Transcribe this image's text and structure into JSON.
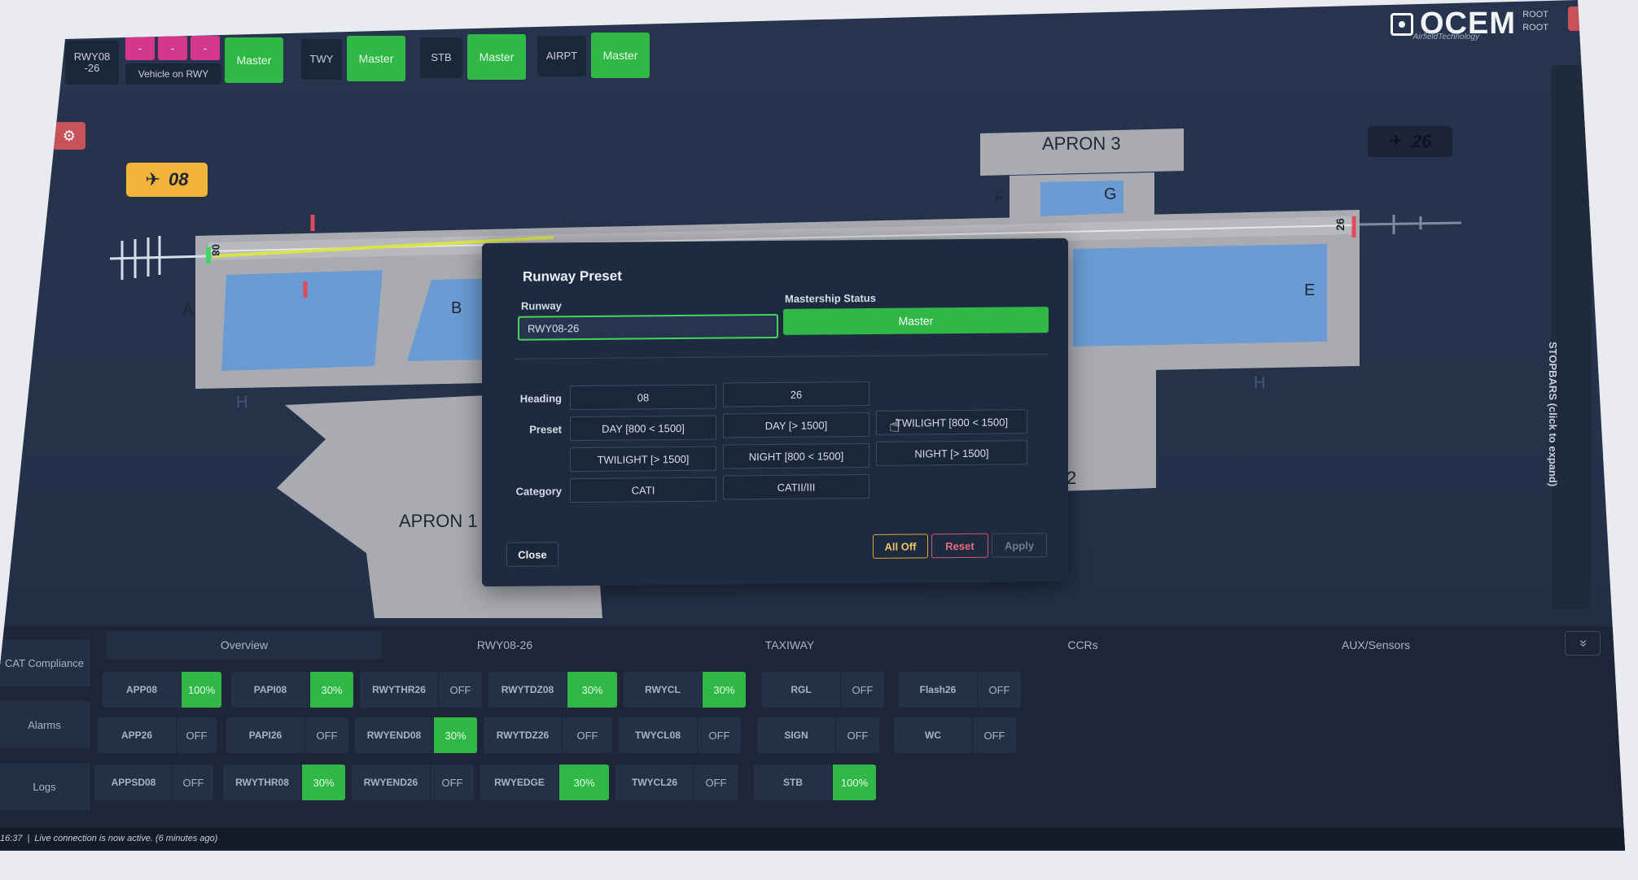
{
  "toolbar": {
    "runway_id": "RWY08\n-26",
    "pink_buttons": [
      "-",
      "-",
      "-"
    ],
    "vehicle_on_rwy": "Vehicle on RWY",
    "groups": [
      {
        "label": "TWY",
        "status": "Master"
      },
      {
        "label": "STB",
        "status": "Master"
      },
      {
        "label": "AIRPT",
        "status": "Master"
      }
    ],
    "rwy_status": "Master"
  },
  "brand": {
    "name": "OCEM",
    "subtitle": "AirfieldTechnology",
    "user_line1": "ROOT",
    "user_line2": "ROOT",
    "accent": "#2fb845"
  },
  "map": {
    "heading_left": "08",
    "heading_right": "26",
    "runway_end_left": "08",
    "runway_end_right": "26",
    "aprons": [
      "APRON 3",
      "APRON 1"
    ],
    "apron2_partial": "2",
    "taxiway_letters": [
      "A",
      "B",
      "E",
      "F",
      "G",
      "H",
      "H"
    ],
    "stopbars_label": "STOPBARS (click to expand)"
  },
  "modal": {
    "title": "Runway Preset",
    "runway_label": "Runway",
    "runway_value": "RWY08-26",
    "mastership_label": "Mastership Status",
    "mastership_value": "Master",
    "heading_label": "Heading",
    "headings": [
      "08",
      "26"
    ],
    "preset_label": "Preset",
    "presets": [
      "DAY [800 < 1500]",
      "DAY [> 1500]",
      "TWILIGHT [800 < 1500]",
      "TWILIGHT [> 1500]",
      "NIGHT [800 < 1500]",
      "NIGHT [> 1500]"
    ],
    "category_label": "Category",
    "categories": [
      "CATI",
      "CATII/III"
    ],
    "close": "Close",
    "all_off": "All Off",
    "reset": "Reset",
    "apply": "Apply"
  },
  "bottom": {
    "side_tabs": [
      "CAT Compliance",
      "Alarms",
      "Logs"
    ],
    "tabs": [
      "Overview",
      "RWY08-26",
      "TAXIWAY",
      "CCRs",
      "AUX/Sensors"
    ],
    "collapse": "»",
    "controls": [
      [
        {
          "name": "APP08",
          "value": "100%",
          "on": true
        },
        {
          "name": "PAPI08",
          "value": "30%",
          "on": true
        },
        {
          "name": "RWYTHR26",
          "value": "OFF",
          "on": false
        },
        {
          "name": "RWYTDZ08",
          "value": "30%",
          "on": true
        },
        {
          "name": "RWYCL",
          "value": "30%",
          "on": true
        },
        {
          "name": "RGL",
          "value": "OFF",
          "on": false
        },
        {
          "name": "Flash26",
          "value": "OFF",
          "on": false
        }
      ],
      [
        {
          "name": "APP26",
          "value": "OFF",
          "on": false
        },
        {
          "name": "PAPI26",
          "value": "OFF",
          "on": false
        },
        {
          "name": "RWYEND08",
          "value": "30%",
          "on": true
        },
        {
          "name": "RWYTDZ26",
          "value": "OFF",
          "on": false
        },
        {
          "name": "TWYCL08",
          "value": "OFF",
          "on": false
        },
        {
          "name": "SIGN",
          "value": "OFF",
          "on": false
        },
        {
          "name": "WC",
          "value": "OFF",
          "on": false
        }
      ],
      [
        {
          "name": "APPSD08",
          "value": "OFF",
          "on": false
        },
        {
          "name": "RWYTHR08",
          "value": "30%",
          "on": true
        },
        {
          "name": "RWYEND26",
          "value": "OFF",
          "on": false
        },
        {
          "name": "RWYEDGE",
          "value": "30%",
          "on": true
        },
        {
          "name": "TWYCL26",
          "value": "OFF",
          "on": false
        },
        {
          "name": "STB",
          "value": "100%",
          "on": true
        }
      ]
    ]
  },
  "status": {
    "time": "16:37",
    "message": "Live connection is now active. (6 minutes ago)"
  }
}
